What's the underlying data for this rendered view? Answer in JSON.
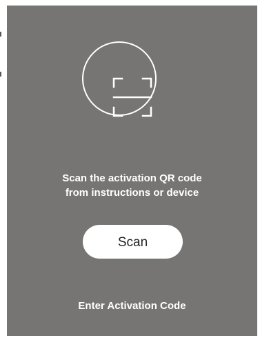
{
  "colors": {
    "panel_background": "#767573",
    "foreground": "#ffffff",
    "button_text": "#222222"
  },
  "scanner": {
    "icon": "qr-scan-frame-icon",
    "instruction_line1": "Scan the activation QR code",
    "instruction_line2": "from instructions or device"
  },
  "actions": {
    "scan_label": "Scan",
    "enter_code_label": "Enter Activation Code"
  }
}
